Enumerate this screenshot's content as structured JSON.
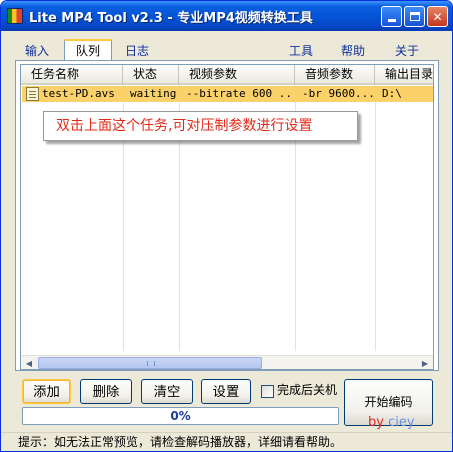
{
  "window": {
    "title": "Lite MP4 Tool v2.3 - 专业MP4视频转换工具"
  },
  "tabs": [
    {
      "label": "输入",
      "selected": false
    },
    {
      "label": "队列",
      "selected": true
    },
    {
      "label": "日志",
      "selected": false
    }
  ],
  "menu": {
    "tools": "工具",
    "help": "帮助",
    "about": "关于"
  },
  "queue": {
    "columns": [
      "任务名称",
      "状态",
      "视频参数",
      "音频参数",
      "输出目录"
    ],
    "rows": [
      {
        "name": "test-PD.avs",
        "status": "waiting",
        "video_params": "--bitrate 600 ...",
        "audio_params": "-br 9600...",
        "output_dir": "D:\\"
      }
    ]
  },
  "callout": {
    "text": "双击上面这个任务,可对压制参数进行设置"
  },
  "buttons": {
    "add": "添加",
    "delete": "删除",
    "clear": "清空",
    "settings": "设置",
    "start": "开始编码"
  },
  "shutdown_checkbox": {
    "label": "完成后关机",
    "checked": false
  },
  "progress": {
    "value": 0,
    "label": "0%"
  },
  "watermark": {
    "by": "by",
    "name": "ciey"
  },
  "status": {
    "tip": "提示：如无法正常预览，请检查解码播放器，详细请看帮助。"
  },
  "icons": {
    "app": "app-icon",
    "file": "avs-file-icon",
    "minimize": "minimize-icon",
    "maximize": "maximize-icon",
    "close": "close-icon"
  },
  "colors": {
    "titlebar": "#0553d6",
    "selected_row": "#fbd26a",
    "callout_text": "#e22a1a",
    "progress_text": "#1c3b9e",
    "window_bg": "#ece9d8"
  }
}
